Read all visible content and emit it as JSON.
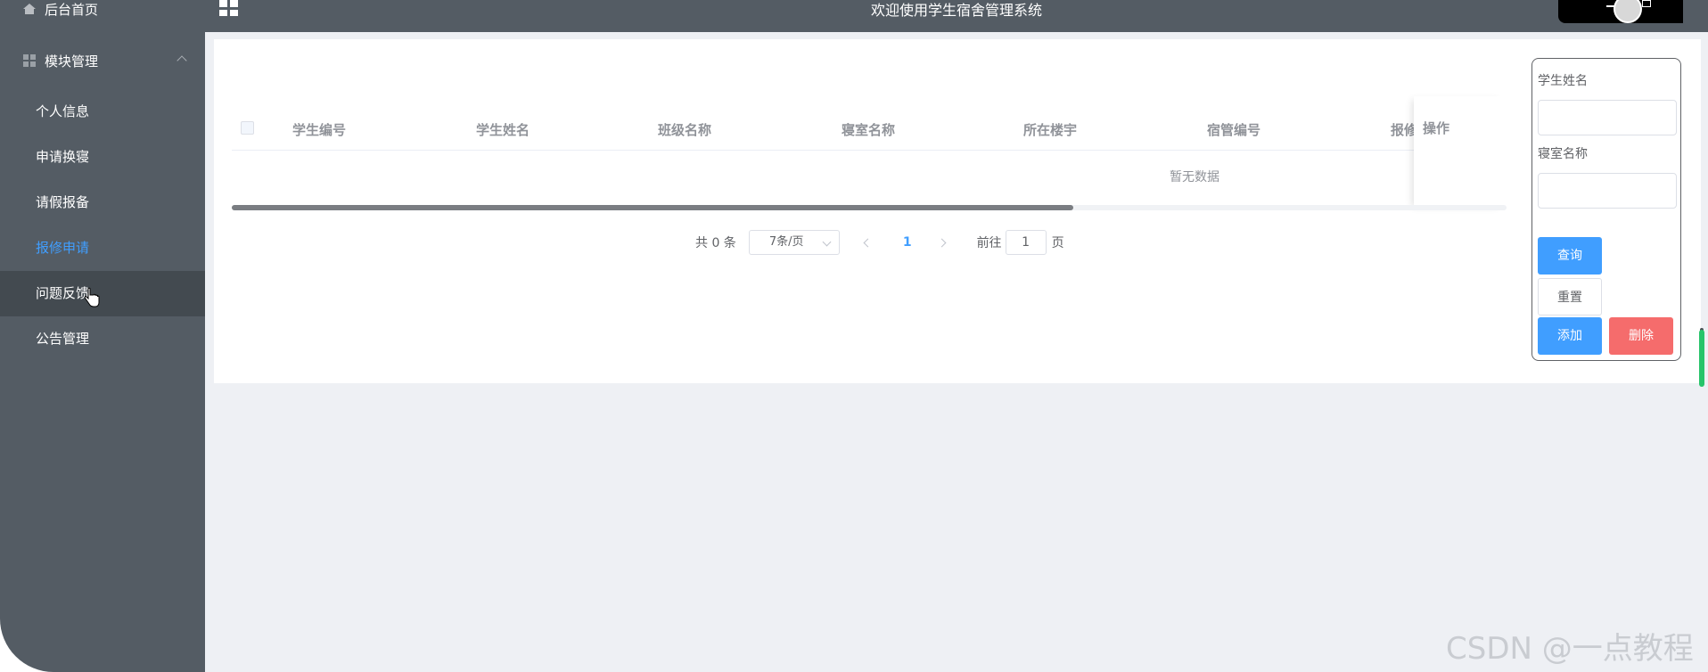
{
  "header": {
    "title": "欢迎使用学生宿舍管理系统"
  },
  "sidebar": {
    "home_label": "后台首页",
    "module_label": "模块管理",
    "items": [
      {
        "label": "个人信息"
      },
      {
        "label": "申请换寝"
      },
      {
        "label": "请假报备"
      },
      {
        "label": "报修申请"
      },
      {
        "label": "问题反馈"
      },
      {
        "label": "公告管理"
      }
    ]
  },
  "table": {
    "columns": [
      "学生编号",
      "学生姓名",
      "班级名称",
      "寝室名称",
      "所在楼宇",
      "宿管编号",
      "报修"
    ],
    "fixed_column": "操作",
    "empty_text": "暂无数据"
  },
  "pagination": {
    "total_text": "共 0 条",
    "page_size": "7条/页",
    "current_page": "1",
    "goto_prefix": "前往",
    "goto_value": "1",
    "goto_suffix": "页"
  },
  "search": {
    "field1_label": "学生姓名",
    "field2_label": "寝室名称",
    "query_button": "查询",
    "reset_button": "重置",
    "add_button": "添加",
    "delete_button": "删除"
  },
  "watermark": "CSDN @一点教程",
  "colors": {
    "sidebar_bg": "#545c64",
    "accent": "#409eff",
    "danger": "#f56c6c",
    "content_bg": "#eef0f4"
  }
}
